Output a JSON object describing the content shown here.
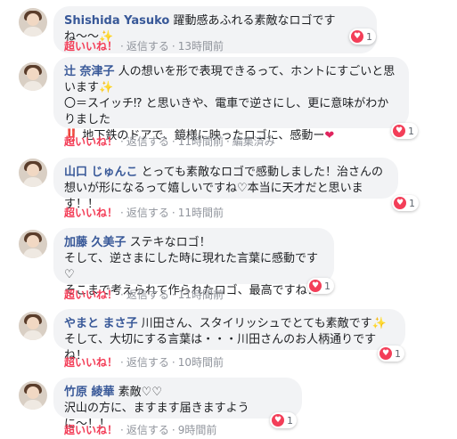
{
  "actions": {
    "like": "超いいね！",
    "reply": "返信する",
    "edited": "編集済み",
    "dot": "·"
  },
  "comments": [
    {
      "name": "Shishida Yasuko",
      "text": " 躍動感あふれる素敵なロゴですね〜〜",
      "suffix": "✨",
      "reactions": "1",
      "time": "13時間前"
    },
    {
      "name": "辻 奈津子",
      "text": " 人の想いを形で表現できるって、ホントにすごいと思います",
      "suffix": "✨",
      "text2": "〇＝スイッチ⁉ と思いきや、電車で逆さにし、更に意味がわかりました",
      "bang": "‼️",
      "text3": " 地下鉄のドアで、鏡様に映ったロゴに、感動ー",
      "heart": "❤",
      "reactions": "1",
      "time": "11時間前"
    },
    {
      "name": "山口 じゅんこ",
      "text": " とっても素敵なロゴで感動しました！治さんの想いが形になるって嬉しいですね♡本当に天才だと思います！！",
      "reactions": "1",
      "time": "11時間前"
    },
    {
      "name": "加藤 久美子",
      "text": " ステキなロゴ！\nそして、逆さまにした時に現れた言葉に感動です♡\nそこまで考えられて作られたロゴ、最高ですね！",
      "reactions": "1",
      "time": "11時間前"
    },
    {
      "name": "やまと まさ子",
      "text": " 川田さん、スタイリッシュでとても素敵です",
      "suffix": "✨",
      "text2": "そして、大切にする言葉は・・・川田さんのお人柄通りですね！",
      "reactions": "1",
      "time": "10時間前"
    },
    {
      "name": "竹原 綾華",
      "text": " 素敵♡♡\n沢山の方に、ますます届きますように〜！！",
      "reactions": "1",
      "time": "9時間前"
    }
  ]
}
